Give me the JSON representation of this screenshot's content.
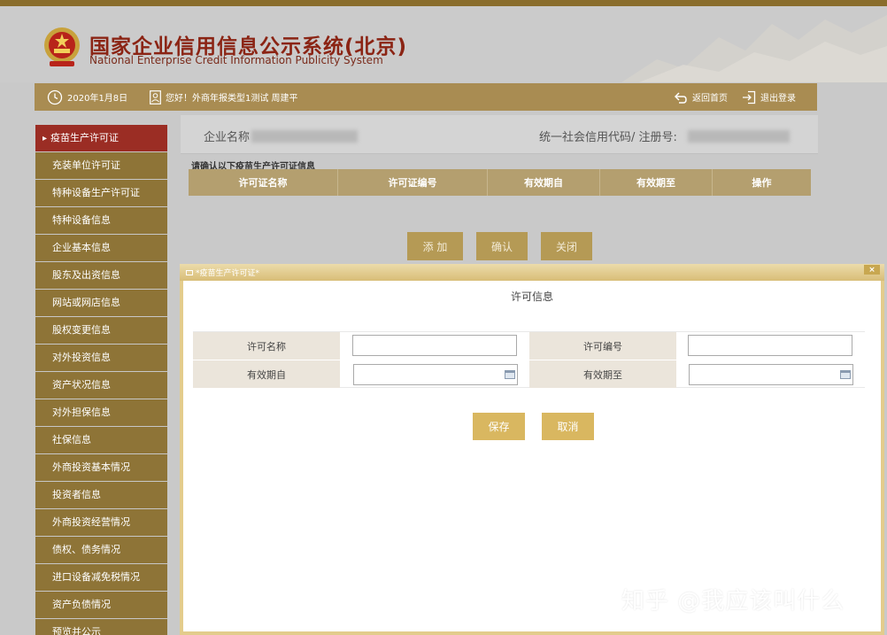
{
  "header": {
    "title_cn": "国家企业信用信息公示系统(北京)",
    "title_en": "National Enterprise Credit Information Publicity System"
  },
  "infobar": {
    "date": "2020年1月8日",
    "greeting": "您好！外商年报类型1测试 周建平",
    "home_label": "返回首页",
    "logout_label": "退出登录"
  },
  "sidebar": {
    "items": [
      {
        "label": "疫苗生产许可证",
        "active": true
      },
      {
        "label": "充装单位许可证"
      },
      {
        "label": "特种设备生产许可证"
      },
      {
        "label": "特种设备信息"
      },
      {
        "label": "企业基本信息"
      },
      {
        "label": "股东及出资信息"
      },
      {
        "label": "网站或网店信息"
      },
      {
        "label": "股权变更信息"
      },
      {
        "label": "对外投资信息"
      },
      {
        "label": "资产状况信息"
      },
      {
        "label": "对外担保信息"
      },
      {
        "label": "社保信息"
      },
      {
        "label": "外商投资基本情况"
      },
      {
        "label": "投资者信息"
      },
      {
        "label": "外商投资经营情况"
      },
      {
        "label": "债权、债务情况"
      },
      {
        "label": "进口设备减免税情况"
      },
      {
        "label": "资产负债情况"
      },
      {
        "label": "预览并公示"
      }
    ]
  },
  "main": {
    "company_label": "企业名称",
    "code_label": "统一社会信用代码/ 注册号:",
    "confirm_text": "请确认以下疫苗生产许可证信息",
    "columns": [
      "许可证名称",
      "许可证编号",
      "有效期自",
      "有效期至",
      "操作"
    ],
    "buttons": {
      "add": "添 加",
      "confirm": "确认",
      "close": "关闭"
    }
  },
  "modal": {
    "title": "*疫苗生产许可证*",
    "close_glyph": "×",
    "heading": "许可信息",
    "fields": {
      "license_name": {
        "label": "许可名称",
        "value": ""
      },
      "license_no": {
        "label": "许可编号",
        "value": ""
      },
      "valid_from": {
        "label": "有效期自",
        "value": ""
      },
      "valid_to": {
        "label": "有效期至",
        "value": ""
      }
    },
    "save_label": "保存",
    "cancel_label": "取消"
  },
  "watermark": "知乎 @我应该叫什么",
  "colors": {
    "nav_bg": "#8e7437",
    "nav_active": "#9b2d24",
    "infobar": "#a98c52",
    "table_head": "#b49f6f",
    "modal_button": "#d9b760",
    "title_red": "#8b2414"
  }
}
